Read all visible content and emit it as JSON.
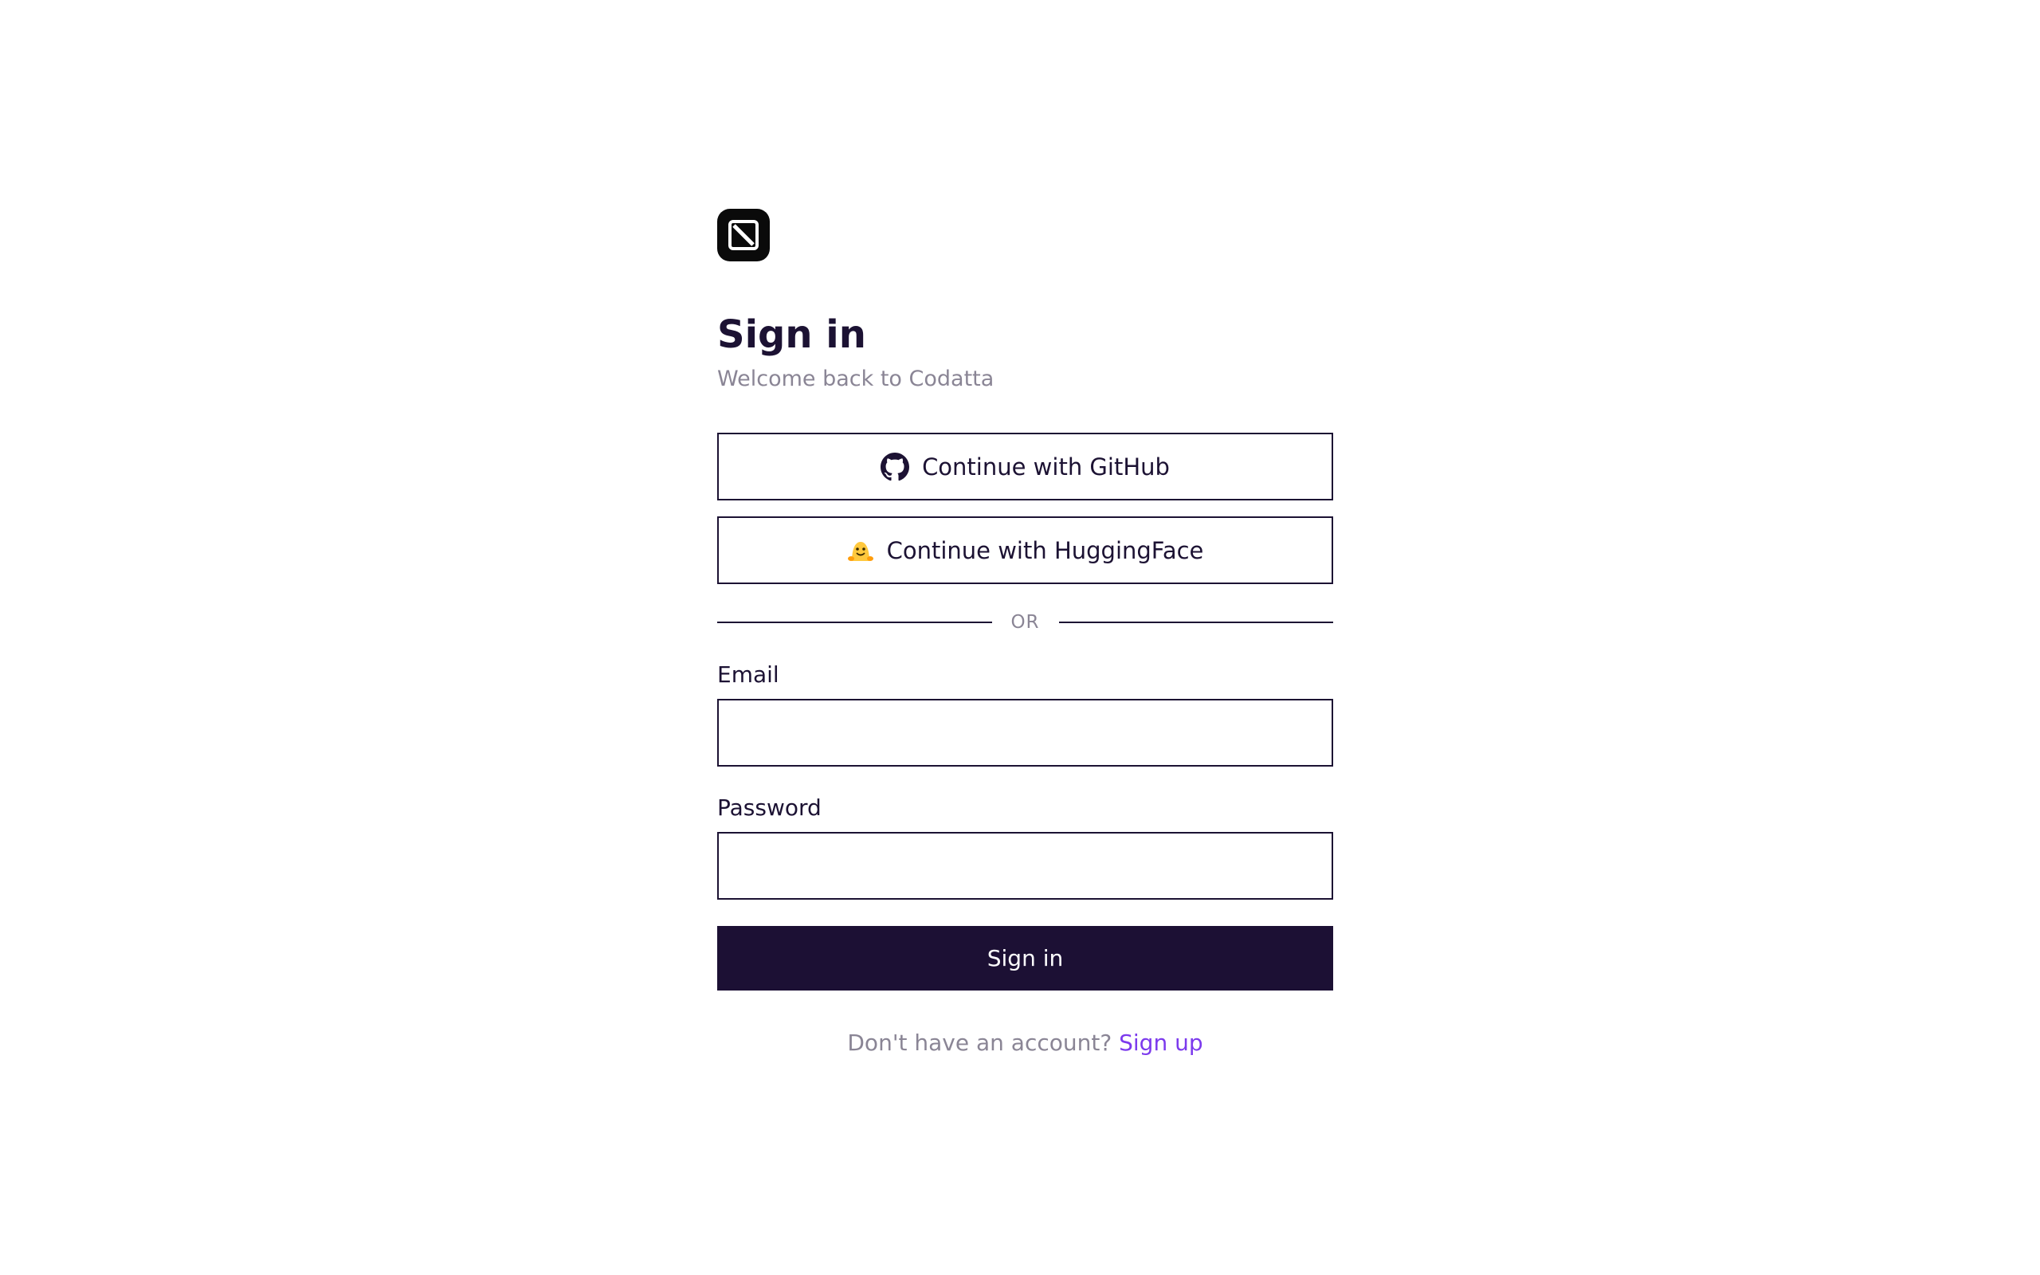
{
  "logo": {
    "icon": "codatta-logo-icon"
  },
  "header": {
    "title": "Sign in",
    "subtitle": "Welcome back to Codatta"
  },
  "oauth": {
    "github_label": "Continue with GitHub",
    "huggingface_label": "Continue with HuggingFace"
  },
  "divider": {
    "text": "OR"
  },
  "form": {
    "email_label": "Email",
    "email_value": "",
    "password_label": "Password",
    "password_value": "",
    "submit_label": "Sign in"
  },
  "footer": {
    "prompt": "Don't have an account?",
    "signup_label": "Sign up"
  },
  "colors": {
    "primary": "#1c1034",
    "text": "#1c1233",
    "muted": "#8a8595",
    "link": "#7c3aed",
    "huggingface": "#ffc83d"
  }
}
